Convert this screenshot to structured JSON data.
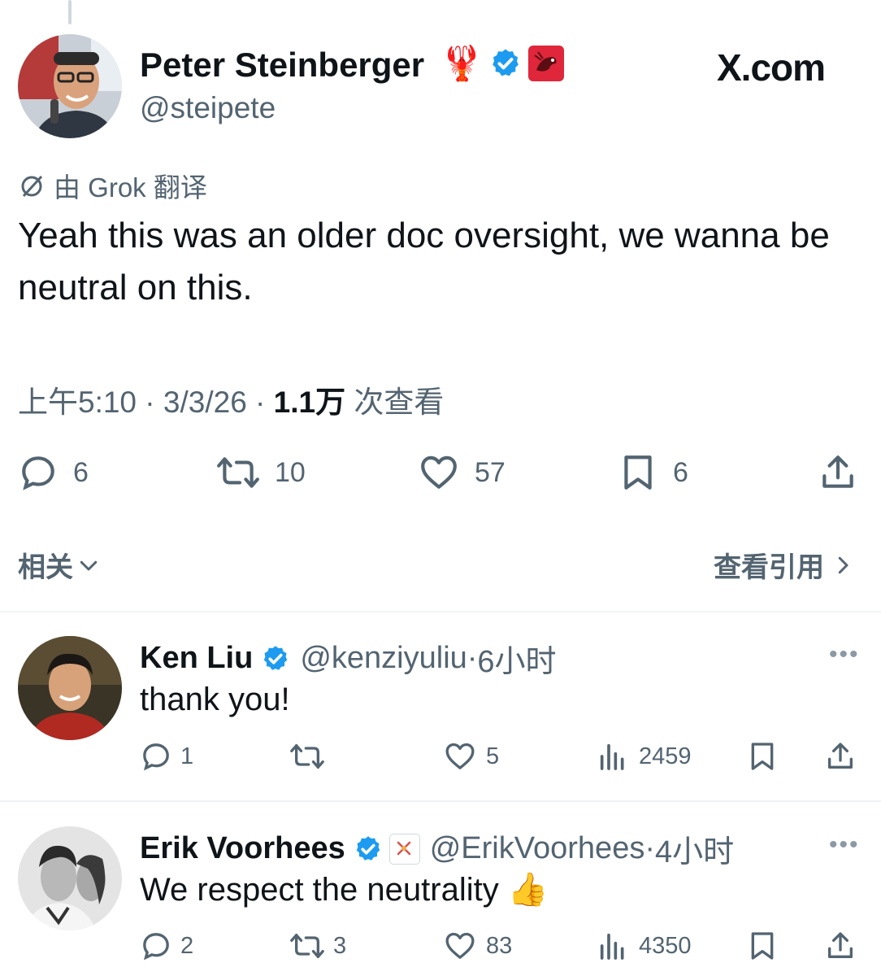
{
  "main_tweet": {
    "author_name": "Peter Steinberger",
    "author_handle": "@steipete",
    "brand": "X.com",
    "lobster_emoji": "🦞",
    "translated_by": "由 Grok 翻译",
    "text": "Yeah this was an older doc oversight, we wanna be neutral on this.",
    "time": "上午5:10",
    "date": "3/3/26",
    "views_count": "1.1万",
    "views_label": "次查看",
    "replies": "6",
    "retweets": "10",
    "likes": "57",
    "bookmarks": "6"
  },
  "related_bar": {
    "related_label": "相关",
    "view_quotes_label": "查看引用"
  },
  "replies": [
    {
      "name": "Ken Liu",
      "handle": "@kenziyuliu",
      "time": "6小时",
      "text": "thank you!",
      "replies": "1",
      "retweets": "",
      "likes": "5",
      "views": "2459"
    },
    {
      "name": "Erik Voorhees",
      "handle": "@ErikVoorhees",
      "time": "4小时",
      "text": "We respect the neutrality",
      "emoji": "👍",
      "replies": "2",
      "retweets": "3",
      "likes": "83",
      "views": "4350"
    }
  ],
  "colors": {
    "verified_blue": "#1d9bf0",
    "secondary_text": "#536471",
    "primary_text": "#0f1419",
    "divider": "#eff3f4"
  }
}
